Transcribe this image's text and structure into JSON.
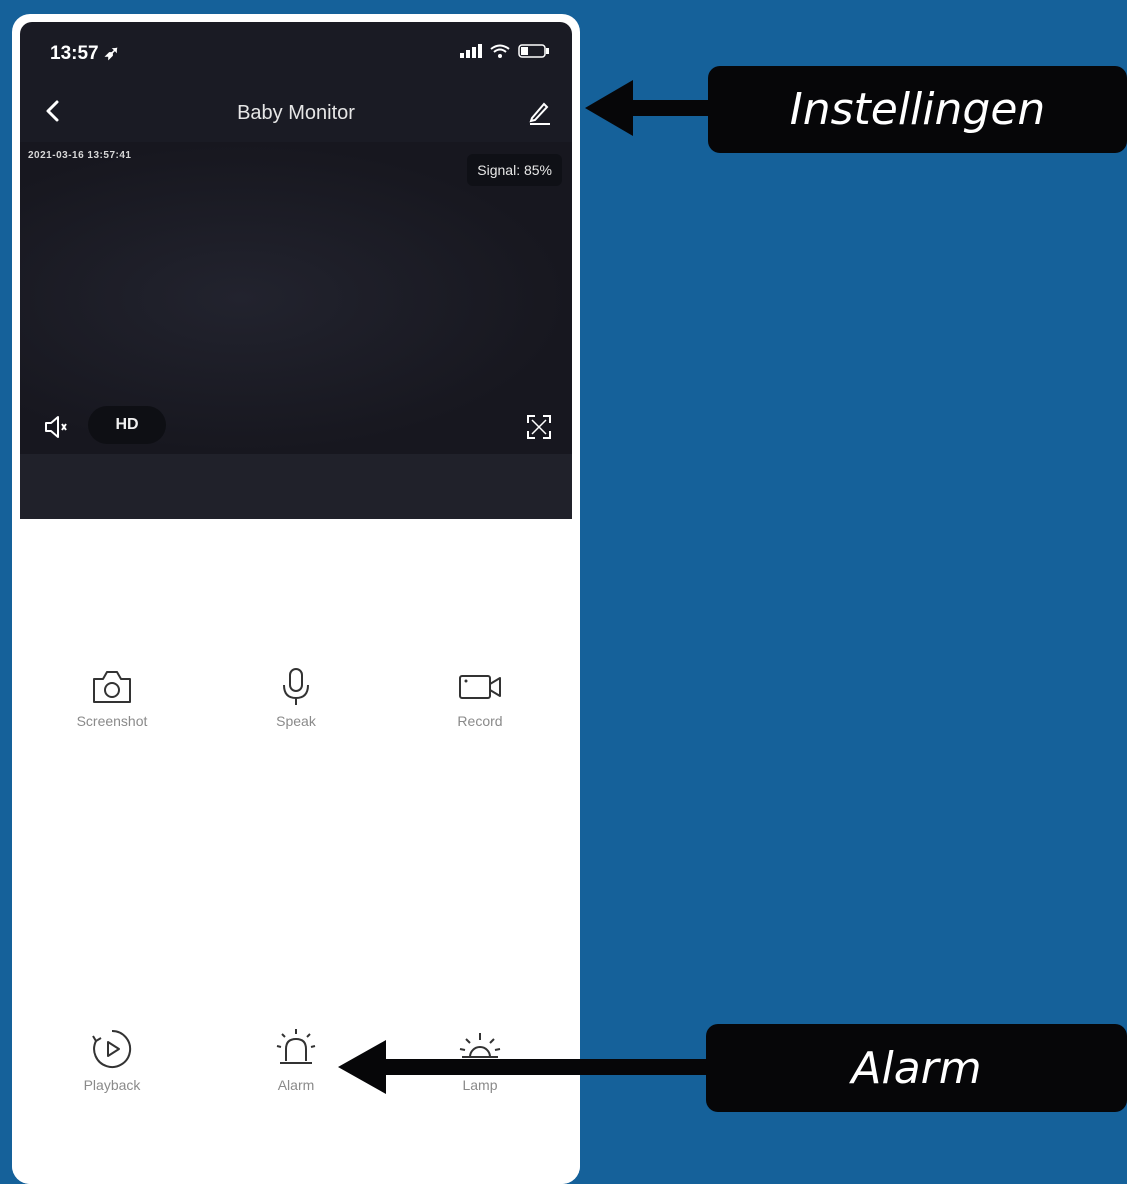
{
  "status_bar": {
    "time": "13:57 ➶"
  },
  "nav": {
    "title": "Baby Monitor"
  },
  "video": {
    "timestamp": "2021-03-16 13:57:41",
    "signal": "Signal: 85%",
    "quality": "HD"
  },
  "controls": [
    {
      "label": "Screenshot",
      "icon": "camera-icon"
    },
    {
      "label": "Speak",
      "icon": "microphone-icon"
    },
    {
      "label": "Record",
      "icon": "video-camera-icon"
    },
    {
      "label": "Playback",
      "icon": "playback-icon"
    },
    {
      "label": "Alarm",
      "icon": "alarm-icon"
    },
    {
      "label": "Lamp",
      "icon": "lamp-icon"
    }
  ],
  "callouts": {
    "settings": "Instellingen",
    "alarm": "Alarm"
  },
  "colors": {
    "background": "#15619a",
    "screen": "#1a1b24",
    "callout": "#060608",
    "label": "#8a8a8a"
  }
}
